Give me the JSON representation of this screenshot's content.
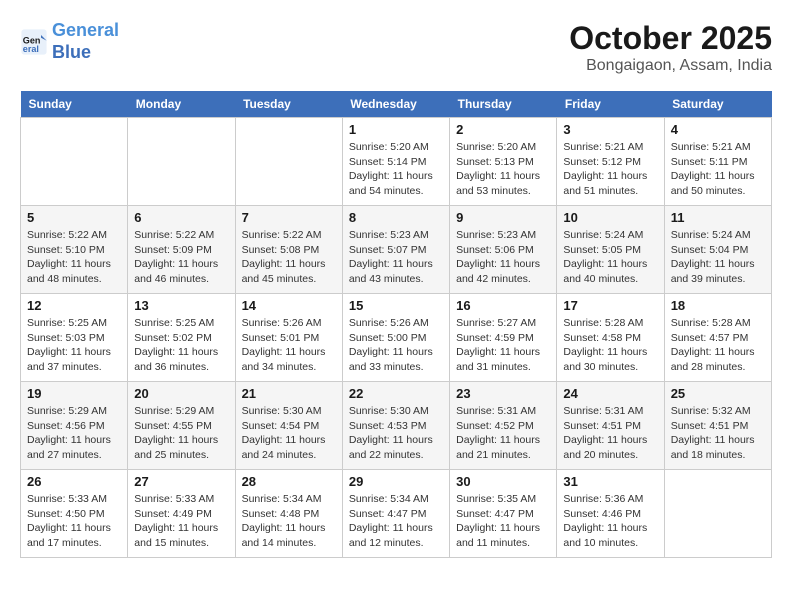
{
  "header": {
    "logo_line1": "General",
    "logo_line2": "Blue",
    "month": "October 2025",
    "location": "Bongaigaon, Assam, India"
  },
  "days_of_week": [
    "Sunday",
    "Monday",
    "Tuesday",
    "Wednesday",
    "Thursday",
    "Friday",
    "Saturday"
  ],
  "weeks": [
    [
      {
        "day": "",
        "info": ""
      },
      {
        "day": "",
        "info": ""
      },
      {
        "day": "",
        "info": ""
      },
      {
        "day": "1",
        "info": "Sunrise: 5:20 AM\nSunset: 5:14 PM\nDaylight: 11 hours\nand 54 minutes."
      },
      {
        "day": "2",
        "info": "Sunrise: 5:20 AM\nSunset: 5:13 PM\nDaylight: 11 hours\nand 53 minutes."
      },
      {
        "day": "3",
        "info": "Sunrise: 5:21 AM\nSunset: 5:12 PM\nDaylight: 11 hours\nand 51 minutes."
      },
      {
        "day": "4",
        "info": "Sunrise: 5:21 AM\nSunset: 5:11 PM\nDaylight: 11 hours\nand 50 minutes."
      }
    ],
    [
      {
        "day": "5",
        "info": "Sunrise: 5:22 AM\nSunset: 5:10 PM\nDaylight: 11 hours\nand 48 minutes."
      },
      {
        "day": "6",
        "info": "Sunrise: 5:22 AM\nSunset: 5:09 PM\nDaylight: 11 hours\nand 46 minutes."
      },
      {
        "day": "7",
        "info": "Sunrise: 5:22 AM\nSunset: 5:08 PM\nDaylight: 11 hours\nand 45 minutes."
      },
      {
        "day": "8",
        "info": "Sunrise: 5:23 AM\nSunset: 5:07 PM\nDaylight: 11 hours\nand 43 minutes."
      },
      {
        "day": "9",
        "info": "Sunrise: 5:23 AM\nSunset: 5:06 PM\nDaylight: 11 hours\nand 42 minutes."
      },
      {
        "day": "10",
        "info": "Sunrise: 5:24 AM\nSunset: 5:05 PM\nDaylight: 11 hours\nand 40 minutes."
      },
      {
        "day": "11",
        "info": "Sunrise: 5:24 AM\nSunset: 5:04 PM\nDaylight: 11 hours\nand 39 minutes."
      }
    ],
    [
      {
        "day": "12",
        "info": "Sunrise: 5:25 AM\nSunset: 5:03 PM\nDaylight: 11 hours\nand 37 minutes."
      },
      {
        "day": "13",
        "info": "Sunrise: 5:25 AM\nSunset: 5:02 PM\nDaylight: 11 hours\nand 36 minutes."
      },
      {
        "day": "14",
        "info": "Sunrise: 5:26 AM\nSunset: 5:01 PM\nDaylight: 11 hours\nand 34 minutes."
      },
      {
        "day": "15",
        "info": "Sunrise: 5:26 AM\nSunset: 5:00 PM\nDaylight: 11 hours\nand 33 minutes."
      },
      {
        "day": "16",
        "info": "Sunrise: 5:27 AM\nSunset: 4:59 PM\nDaylight: 11 hours\nand 31 minutes."
      },
      {
        "day": "17",
        "info": "Sunrise: 5:28 AM\nSunset: 4:58 PM\nDaylight: 11 hours\nand 30 minutes."
      },
      {
        "day": "18",
        "info": "Sunrise: 5:28 AM\nSunset: 4:57 PM\nDaylight: 11 hours\nand 28 minutes."
      }
    ],
    [
      {
        "day": "19",
        "info": "Sunrise: 5:29 AM\nSunset: 4:56 PM\nDaylight: 11 hours\nand 27 minutes."
      },
      {
        "day": "20",
        "info": "Sunrise: 5:29 AM\nSunset: 4:55 PM\nDaylight: 11 hours\nand 25 minutes."
      },
      {
        "day": "21",
        "info": "Sunrise: 5:30 AM\nSunset: 4:54 PM\nDaylight: 11 hours\nand 24 minutes."
      },
      {
        "day": "22",
        "info": "Sunrise: 5:30 AM\nSunset: 4:53 PM\nDaylight: 11 hours\nand 22 minutes."
      },
      {
        "day": "23",
        "info": "Sunrise: 5:31 AM\nSunset: 4:52 PM\nDaylight: 11 hours\nand 21 minutes."
      },
      {
        "day": "24",
        "info": "Sunrise: 5:31 AM\nSunset: 4:51 PM\nDaylight: 11 hours\nand 20 minutes."
      },
      {
        "day": "25",
        "info": "Sunrise: 5:32 AM\nSunset: 4:51 PM\nDaylight: 11 hours\nand 18 minutes."
      }
    ],
    [
      {
        "day": "26",
        "info": "Sunrise: 5:33 AM\nSunset: 4:50 PM\nDaylight: 11 hours\nand 17 minutes."
      },
      {
        "day": "27",
        "info": "Sunrise: 5:33 AM\nSunset: 4:49 PM\nDaylight: 11 hours\nand 15 minutes."
      },
      {
        "day": "28",
        "info": "Sunrise: 5:34 AM\nSunset: 4:48 PM\nDaylight: 11 hours\nand 14 minutes."
      },
      {
        "day": "29",
        "info": "Sunrise: 5:34 AM\nSunset: 4:47 PM\nDaylight: 11 hours\nand 12 minutes."
      },
      {
        "day": "30",
        "info": "Sunrise: 5:35 AM\nSunset: 4:47 PM\nDaylight: 11 hours\nand 11 minutes."
      },
      {
        "day": "31",
        "info": "Sunrise: 5:36 AM\nSunset: 4:46 PM\nDaylight: 11 hours\nand 10 minutes."
      },
      {
        "day": "",
        "info": ""
      }
    ]
  ]
}
